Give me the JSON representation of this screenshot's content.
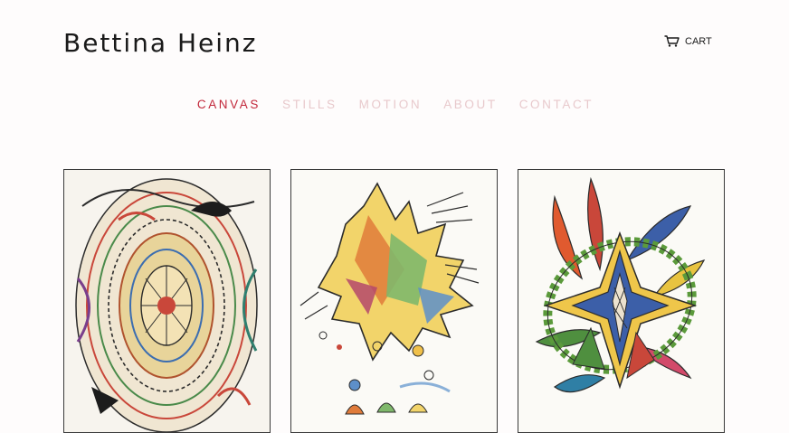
{
  "header": {
    "site_title": "Bettina Heinz",
    "cart_label": "CART",
    "cart_icon": "shopping-cart-icon"
  },
  "nav": {
    "active_color": "#c2273a",
    "inactive_color": "#e8c9cc",
    "items": [
      {
        "label": "CANVAS",
        "active": true
      },
      {
        "label": "STILLS",
        "active": false
      },
      {
        "label": "MOTION",
        "active": false
      },
      {
        "label": "ABOUT",
        "active": false
      },
      {
        "label": "CONTACT",
        "active": false
      }
    ]
  },
  "gallery": {
    "items": [
      {
        "kind": "artwork",
        "style": "dense ornamental colored-pencil drawing"
      },
      {
        "kind": "artwork",
        "style": "spiky feather-like colored-pencil drawing with floating spheres"
      },
      {
        "kind": "artwork",
        "style": "geometric star with curved horn shapes, colored pencil"
      }
    ]
  }
}
